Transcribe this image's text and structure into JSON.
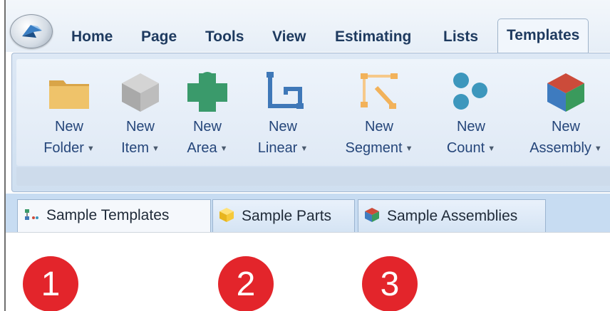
{
  "menu": {
    "tabs": [
      "Home",
      "Page",
      "Tools",
      "View",
      "Estimating",
      "Lists",
      "Templates"
    ],
    "active_tab": "Templates"
  },
  "ribbon": {
    "buttons": [
      {
        "line1": "New",
        "line2": "Folder",
        "icon": "folder-icon",
        "color": "#e9b75a"
      },
      {
        "line1": "New",
        "line2": "Item",
        "icon": "cube-icon",
        "color": "#b8b8b8"
      },
      {
        "line1": "New",
        "line2": "Area",
        "icon": "area-shape-icon",
        "color": "#3a9a6b"
      },
      {
        "line1": "New",
        "line2": "Linear",
        "icon": "linear-shape-icon",
        "color": "#3f78b8"
      },
      {
        "line1": "New",
        "line2": "Segment",
        "icon": "segment-shape-icon",
        "color": "#f2b25a"
      },
      {
        "line1": "New",
        "line2": "Count",
        "icon": "count-dots-icon",
        "color": "#3d97bd"
      },
      {
        "line1": "New",
        "line2": "Assembly",
        "icon": "assembly-cube-icon",
        "color": "#cc4b3a"
      }
    ]
  },
  "doc_tabs": [
    {
      "label": "Sample Templates",
      "icon": "templates-icon"
    },
    {
      "label": "Sample Parts",
      "icon": "yellow-cube-icon"
    },
    {
      "label": "Sample Assemblies",
      "icon": "color-cube-icon"
    }
  ],
  "badges": [
    "1",
    "2",
    "3"
  ]
}
